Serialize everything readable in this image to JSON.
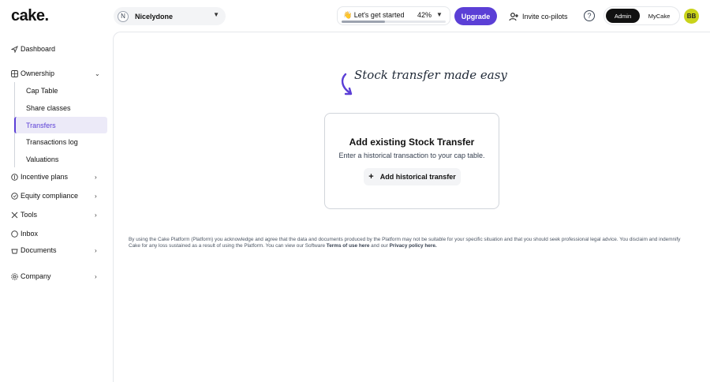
{
  "header": {
    "logo": "cake.",
    "company": {
      "initial": "N",
      "name": "Nicelydone"
    },
    "get_started": {
      "label": "👋 Let's get started",
      "percent_label": "42%",
      "progress": 0.42
    },
    "upgrade_label": "Upgrade",
    "invite_label": "Invite co-pilots",
    "help_icon": "?",
    "role_toggle": {
      "admin": "Admin",
      "mycake": "MyCake",
      "selected": "Admin"
    },
    "avatar_initials": "BB"
  },
  "sidebar": {
    "dashboard": "Dashboard",
    "ownership": "Ownership",
    "ownership_items": [
      "Cap Table",
      "Share classes",
      "Transfers",
      "Transactions log",
      "Valuations"
    ],
    "active_item": "Transfers",
    "incentive_plans": "Incentive plans",
    "equity_compliance": "Equity compliance",
    "tools": "Tools",
    "inbox": "Inbox",
    "documents": "Documents",
    "company": "Company"
  },
  "main": {
    "hand_title": "Stock transfer made easy",
    "card": {
      "title": "Add existing Stock Transfer",
      "description": "Enter a historical transaction to your cap table.",
      "button_label": "Add historical transfer"
    },
    "disclaimer": {
      "text": "By using the Cake Platform (Platform) you acknowledge and agree that the data and documents produced by the Platform may not be suitable for your specific situation and that you should seek professional legal advice. You disclaim and indemnify Cake for any loss sustained as a result of using the Platform. You can view our Software",
      "terms_link": "Terms of use here",
      "and_our": "and our",
      "privacy_link": "Privacy policy here."
    }
  },
  "colors": {
    "accent": "#5b3fd6",
    "avatar": "#c9d31a",
    "active_bg": "#eceaf8"
  }
}
